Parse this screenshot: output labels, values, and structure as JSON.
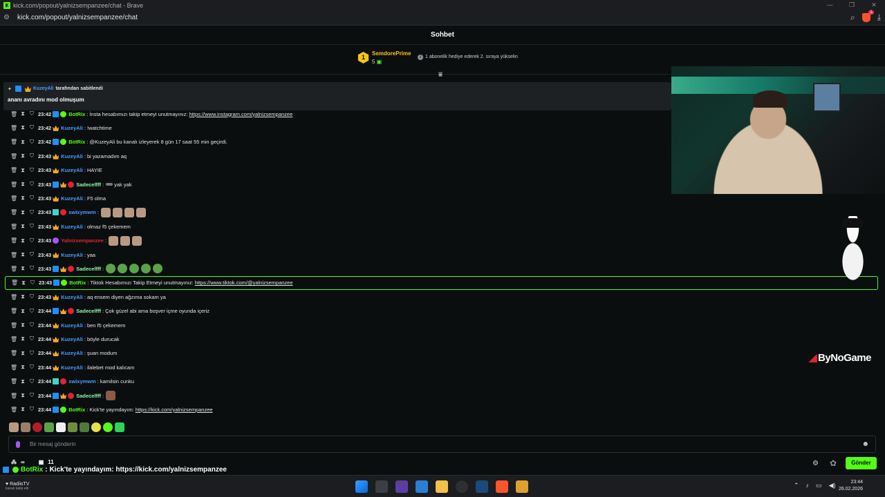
{
  "browser": {
    "title": "kick.com/popout/yalnizsempanzee/chat - Brave",
    "url": "kick.com/popout/yalnizsempanzee/chat",
    "brave_badge": "1"
  },
  "chat": {
    "header": "Sohbet",
    "leaderboard": {
      "rank": "1",
      "name": "SemdorePrime",
      "count": "5",
      "info": "1 abonelik hediye ederek 2. sıraya yükselin"
    },
    "pinned": {
      "user": "KuzeyAli",
      "by_text": "tarafından sabitlendi",
      "message": "ananı avradını mod olmuşum"
    },
    "messages": [
      {
        "time": "23:42",
        "user": "BotRix",
        "color": "#53fc18",
        "badges": [
          "mod",
          "bot"
        ],
        "text": "İnsta hesabımızı takip etmeyi unutmayınız: ",
        "link": "https://www.instagram.com/yalnizsempanzee",
        "emotes": []
      },
      {
        "time": "23:42",
        "user": "KuzeyAli",
        "color": "#4c9bff",
        "badges": [
          "vip"
        ],
        "text": "!watchtime",
        "link": "",
        "emotes": []
      },
      {
        "time": "23:42",
        "user": "BotRix",
        "color": "#53fc18",
        "badges": [
          "mod",
          "bot"
        ],
        "text": "@KuzeyAli bu kanalı izleyerek 8 gün 17 saat 55 min geçirdi.",
        "link": "",
        "emotes": []
      },
      {
        "time": "23:43",
        "user": "KuzeyAli",
        "color": "#4c9bff",
        "badges": [
          "vip"
        ],
        "text": "bi yazamadım aq",
        "link": "",
        "emotes": []
      },
      {
        "time": "23:43",
        "user": "KuzeyAli",
        "color": "#4c9bff",
        "badges": [
          "vip"
        ],
        "text": "HAYIE",
        "link": "",
        "emotes": []
      },
      {
        "time": "23:43",
        "user": "Sadecelfff",
        "color": "#8ef5a8",
        "badges": [
          "mod",
          "vip",
          "red"
        ],
        "text": "yak yak",
        "link": "",
        "emotes": [
          "knife"
        ]
      },
      {
        "time": "23:43",
        "user": "KuzeyAli",
        "color": "#4c9bff",
        "badges": [
          "vip"
        ],
        "text": "F5 olma",
        "link": "",
        "emotes": []
      },
      {
        "time": "23:43",
        "user": "swixymwm",
        "color": "#4c9bff",
        "badges": [
          "gift",
          "red"
        ],
        "text": "",
        "link": "",
        "emotes": [
          "face",
          "face",
          "face",
          "face"
        ]
      },
      {
        "time": "23:43",
        "user": "KuzeyAli",
        "color": "#4c9bff",
        "badges": [
          "vip"
        ],
        "text": "olmaz f5 çekemem",
        "link": "",
        "emotes": []
      },
      {
        "time": "23:43",
        "user": "Yalnizsempanzee",
        "color": "#e0242f",
        "badges": [
          "pur"
        ],
        "text": "",
        "link": "",
        "emotes": [
          "face",
          "face",
          "face"
        ]
      },
      {
        "time": "23:43",
        "user": "KuzeyAli",
        "color": "#4c9bff",
        "badges": [
          "vip"
        ],
        "text": "yaa",
        "link": "",
        "emotes": []
      },
      {
        "time": "23:43",
        "user": "Sadecelfff",
        "color": "#8ef5a8",
        "badges": [
          "mod",
          "vip",
          "red"
        ],
        "text": "",
        "link": "",
        "emotes": [
          "pepe",
          "pepe",
          "pepe",
          "pepe",
          "pepe"
        ]
      },
      {
        "time": "23:43",
        "user": "BotRix",
        "color": "#53fc18",
        "badges": [
          "mod",
          "bot"
        ],
        "text": "Tiktok Hesabımızı Takip Etmeyi unutmayınız: ",
        "link": "https://www.tiktok.com/@yalnizsempanzee",
        "emotes": [],
        "highlight": true
      },
      {
        "time": "23:43",
        "user": "KuzeyAli",
        "color": "#4c9bff",
        "badges": [
          "vip"
        ],
        "text": "aq ensem diyen ağzıma sokam ya",
        "link": "",
        "emotes": []
      },
      {
        "time": "23:44",
        "user": "Sadecelfff",
        "color": "#8ef5a8",
        "badges": [
          "mod",
          "vip",
          "red"
        ],
        "text": "Çok güzel abi ama boşver içme oyunda içeriz",
        "link": "",
        "emotes": []
      },
      {
        "time": "23:44",
        "user": "KuzeyAli",
        "color": "#4c9bff",
        "badges": [
          "vip"
        ],
        "text": "ben f5 çekemem",
        "link": "",
        "emotes": []
      },
      {
        "time": "23:44",
        "user": "KuzeyAli",
        "color": "#4c9bff",
        "badges": [
          "vip"
        ],
        "text": "böyle durucak",
        "link": "",
        "emotes": []
      },
      {
        "time": "23:44",
        "user": "KuzeyAli",
        "color": "#4c9bff",
        "badges": [
          "vip"
        ],
        "text": "şuan modum",
        "link": "",
        "emotes": []
      },
      {
        "time": "23:44",
        "user": "KuzeyAli",
        "color": "#4c9bff",
        "badges": [
          "vip"
        ],
        "text": "ilalebet mod kalıcam",
        "link": "",
        "emotes": []
      },
      {
        "time": "23:44",
        "user": "swixymwm",
        "color": "#4c9bff",
        "badges": [
          "gift",
          "red"
        ],
        "text": "kamilsin cunku",
        "link": "",
        "emotes": []
      },
      {
        "time": "23:44",
        "user": "Sadecelfff",
        "color": "#8ef5a8",
        "badges": [
          "mod",
          "vip",
          "red"
        ],
        "text": "",
        "link": "",
        "emotes": [
          "pop"
        ]
      },
      {
        "time": "23:44",
        "user": "BotRix",
        "color": "#53fc18",
        "badges": [
          "mod",
          "bot"
        ],
        "text": "Kick'te yayındayım: ",
        "link": "https://kick.com/yalnizsempanzee",
        "emotes": []
      }
    ],
    "input_placeholder": "Bir mesaj gönderin",
    "send_label": "Gönder",
    "stats": {
      "infinite": "∞",
      "calendar_count": "11"
    }
  },
  "overlay": {
    "brand": "ByNoGame",
    "ticker_user": "BotRix",
    "ticker_text": "Kick'te yayındayım: https://kick.com/yalnizsempanzee"
  },
  "taskbar": {
    "weather_title": "RadiisTV",
    "weather_sub": "kanalı takip etti",
    "time": "23:44",
    "date": "26.02.2026"
  },
  "colors": {
    "accent": "#53fc18",
    "mod": "#1e8fff",
    "vip": "#f5a623"
  }
}
